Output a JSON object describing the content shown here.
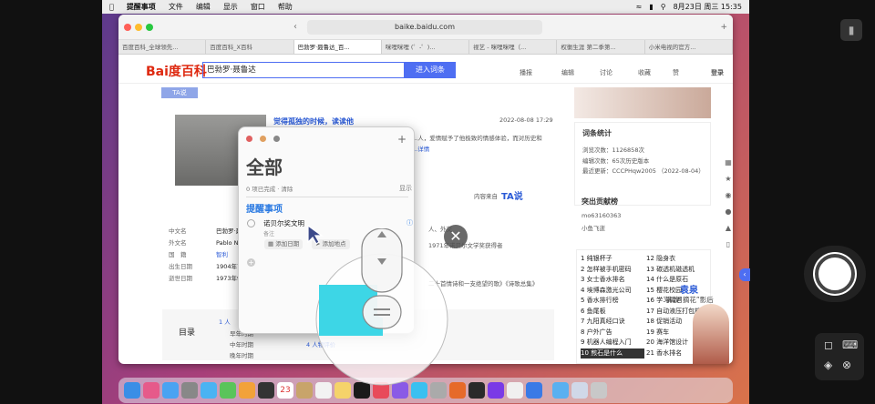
{
  "menubar": {
    "app": "提醒事项",
    "items": [
      "文件",
      "编辑",
      "显示",
      "窗口",
      "帮助"
    ],
    "datetime": "8月23日 周三  15:35"
  },
  "browser": {
    "url": "baike.baidu.com",
    "tabs": [
      "百度百科_全球领先...",
      "百度百科_X百科",
      "巴勃罗·聂鲁达_百...",
      "咪哩咪哩 (゜-゜)...",
      "视艺 - 咪哩咪哩（...",
      "权衡生涯 第二季第...",
      "小米电视的官方..."
    ]
  },
  "baike": {
    "logo": "Bai度百科",
    "search_value": "巴勃罗·聂鲁达",
    "enter_label": "进入词条",
    "nav": [
      "播报",
      "编辑",
      "讨论",
      "收藏",
      "赞"
    ],
    "login": "登录",
    "ta_label": "TA说",
    "article_title": "觉得孤独的时候，读读他",
    "article_date": "2022-08-08 17:29",
    "article_text": "...人，爱情赋予了他极致的情感体验，而对历史和",
    "article_more": "...详情",
    "source_label": "内容来自",
    "source_logo": "TA说",
    "info_rows": [
      {
        "k": "中文名",
        "v": "巴勃罗·聂"
      },
      {
        "k": "外文名",
        "v": "Pablo N"
      },
      {
        "k": "国　籍",
        "v": "智利"
      },
      {
        "k": "出生日期",
        "v": "1904年7"
      },
      {
        "k": "逝世日期",
        "v": "1973年9"
      }
    ],
    "right_info": [
      "人、外交",
      "1971年诺贝尔文学奖获得者",
      "二十首情诗和一支绝望的歌》《诗歌总集》"
    ],
    "toc_title": "目录",
    "toc_items": [
      "1 人",
      "早年时期",
      "中年时期",
      "晚年时期"
    ],
    "toc_items2": [
      "3",
      "4 人物评价"
    ],
    "stats_title": "词条统计",
    "stats": [
      "浏览次数：1126858次",
      "编辑次数：65次历史版本",
      "最近更新：CCCPHqw2005 （2022-08-04）"
    ],
    "contrib_title": "突出贡献榜",
    "contribs": [
      "mo63160363",
      "小鱼飞逝"
    ],
    "hot_left": [
      "1 纯银杯子",
      "2 怎样被手机密码",
      "3 女士香水排名",
      "4 埃博森激光公司",
      "5 香水排行榜",
      "6 鱼尾板",
      "7 九阳真经口诀",
      "8 户外广告",
      "9 机器人编程入门",
      "10 煎石是什么"
    ],
    "hot_right": [
      "12 隐身衣",
      "13 碳透机磁透机",
      "14 什么是原石",
      "15 樱花校园",
      "16 学习调酒",
      "17 自动液压打包机",
      "18 促销活动",
      "19 赛车",
      "20 海洋馆设计",
      "21 香水排名"
    ],
    "promo_name": "袁泉",
    "promo_text": "攀款“摘花”影后"
  },
  "reminders": {
    "title": "全部",
    "completed": "0 项已完成 · 清除",
    "show_label": "显示",
    "section": "提醒事项",
    "item_title": "诺贝尔奖文明",
    "item_note": "备注",
    "add_date": "添加日期",
    "add_location": "添加地点",
    "add_symbol": "+"
  },
  "colors": {
    "accent": "#4e6ef2",
    "joystick": "#3dd6e6",
    "reminder_blue": "#2a7ae2"
  }
}
